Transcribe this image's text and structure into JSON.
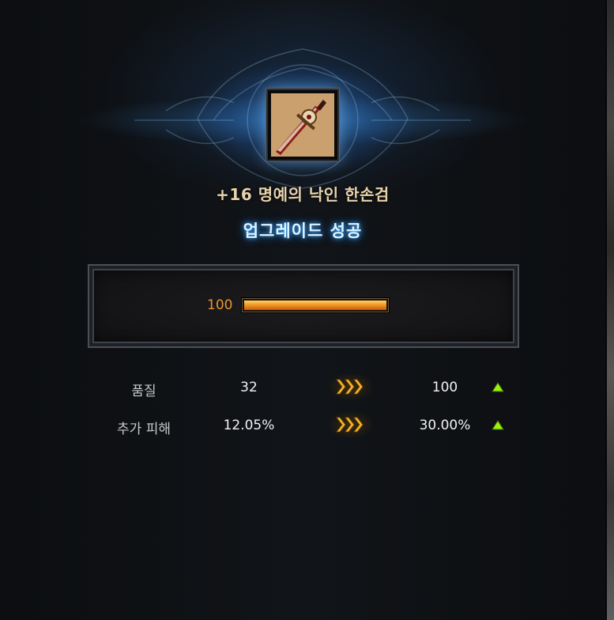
{
  "item": {
    "name": "+16 명예의 낙인 한손검",
    "icon": "one-handed-sword-icon"
  },
  "result": {
    "status": "업그레이드 성공"
  },
  "gauge": {
    "value_label": "100",
    "fill_fraction": 1.0,
    "color": "#f29a24"
  },
  "stats": [
    {
      "label": "품질",
      "before": "32",
      "after": "100",
      "change": "up"
    },
    {
      "label": "추가 피해",
      "before": "12.05%",
      "after": "30.00%",
      "change": "up"
    }
  ],
  "colors": {
    "title": "#e8d3ac",
    "status_glow": "#3aa8ff",
    "value_orange": "#e9952a",
    "arrow_gold": "#f6b928",
    "increase_green": "#9df20a"
  }
}
